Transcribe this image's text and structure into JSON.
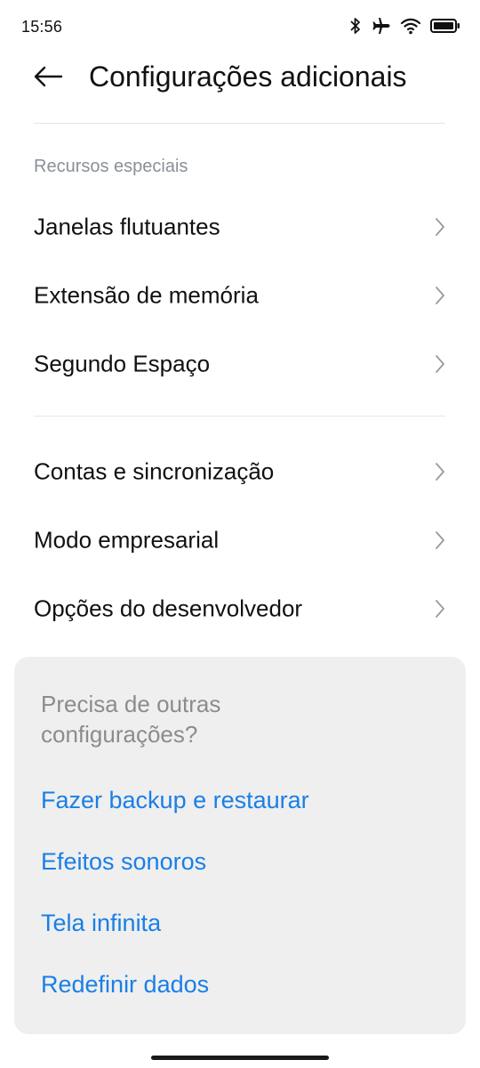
{
  "status_bar": {
    "time": "15:56",
    "icons": [
      "bluetooth-icon",
      "airplane-mode-icon",
      "wifi-icon",
      "battery-icon"
    ]
  },
  "header": {
    "title": "Configurações adicionais",
    "back_icon": "arrow-left-icon"
  },
  "special_features": {
    "header": "Recursos especiais",
    "items": [
      {
        "label": "Janelas flutuantes"
      },
      {
        "label": "Extensão de memória"
      },
      {
        "label": "Segundo Espaço"
      }
    ]
  },
  "more_items": [
    {
      "label": "Contas e sincronização"
    },
    {
      "label": "Modo empresarial"
    },
    {
      "label": "Opções do desenvolvedor"
    }
  ],
  "suggestions": {
    "title": "Precisa de outras configurações?",
    "links": [
      {
        "label": "Fazer backup e restaurar"
      },
      {
        "label": "Efeitos sonoros"
      },
      {
        "label": "Tela infinita"
      },
      {
        "label": "Redefinir dados"
      }
    ]
  },
  "colors": {
    "link": "#1a7fe6",
    "section_header": "#8a8f99",
    "card_background": "#efefef"
  }
}
